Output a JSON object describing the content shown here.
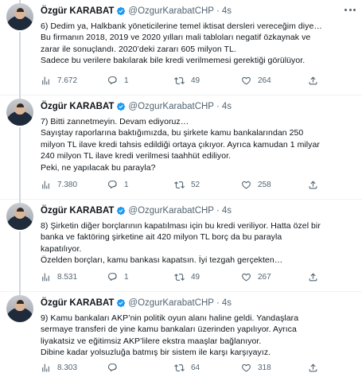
{
  "author": {
    "name": "Özgür KARABAT",
    "handle": "@OzgurKarabatCHP",
    "separator": "·",
    "avatar_icon": "profile-photo",
    "verified_icon": "verified-badge-icon",
    "verified_color": "#1d9bf0"
  },
  "colors": {
    "text": "#0f1419",
    "secondary": "#536471",
    "thread_line": "#cfd9de",
    "divider": "#eff3f4"
  },
  "tweets": [
    {
      "time": "4s",
      "lines": [
        "6) Dedim ya, Halkbank yöneticilerine temel iktisat dersleri vereceğim diye…",
        "Bu firmanın 2018, 2019 ve 2020 yılları mali tabloları negatif özkaynak ve",
        "zarar ile sonuçlandı. 2020’deki zararı 605 milyon TL.",
        "Sadece bu verilere bakılarak bile kredi verilmemesi gerektiği görülüyor."
      ],
      "views": "7.672",
      "replies": "1",
      "retweets": "49",
      "likes": "264"
    },
    {
      "time": "4s",
      "lines": [
        "7) Bitti zannetmeyin. Devam ediyoruz…",
        "Sayıştay raporlarına baktığımızda, bu şirkete kamu bankalarından 250",
        "milyon TL ilave kredi tahsis edildiği ortaya çıkıyor. Ayrıca kamudan 1 milyar",
        "240 milyon TL ilave kredi verilmesi taahhüt ediliyor.",
        "Peki, ne yapılacak bu parayla?"
      ],
      "views": "7.380",
      "replies": "1",
      "retweets": "52",
      "likes": "258"
    },
    {
      "time": "4s",
      "lines": [
        "8) Şirketin diğer borçlarının kapatılması için bu kredi veriliyor. Hatta özel bir",
        "banka ve faktöring şirketine ait 420 milyon TL borç da bu parayla",
        "kapatılıyor.",
        "Özelden borçları, kamu bankası kapatsın. İyi tezgah gerçekten…"
      ],
      "views": "8.531",
      "replies": "1",
      "retweets": "49",
      "likes": "267"
    },
    {
      "time": "4s",
      "lines": [
        "9) Kamu bankaları AKP’nin politik oyun alanı haline geldi. Yandaşlara",
        "sermaye transferi de yine kamu bankaları üzerinden yapılıyor. Ayrıca",
        "liyakatsiz ve eğitimsiz AKP’lilere ekstra maaşlar bağlanıyor.",
        "Dibine kadar yolsuzluğa batmış bir sistem ile karşı karşıyayız."
      ],
      "views": "8.303",
      "replies": "",
      "retweets": "64",
      "likes": "318"
    }
  ]
}
